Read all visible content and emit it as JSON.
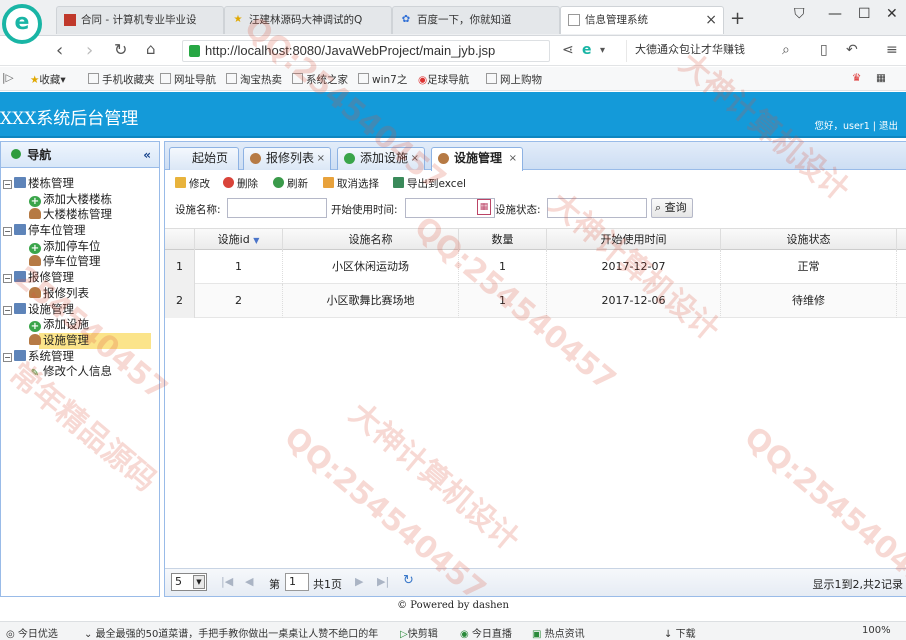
{
  "browser": {
    "tabs": [
      {
        "label": "合同 - 计算机专业毕业设",
        "active": false
      },
      {
        "label": "汪建林源码大神调试的Q",
        "active": false
      },
      {
        "label": "百度一下，你就知道",
        "active": false
      },
      {
        "label": "信息管理系统",
        "active": true
      }
    ],
    "new_tab": "+",
    "url": "http://localhost:8080/JavaWebProject/main_jyb.jsp",
    "search_value": "大德通众包让才华赚钱",
    "bookmarks": [
      "收藏",
      "手机收藏夹",
      "网址导航",
      "淘宝热卖",
      "系统之家",
      "win7之",
      "足球导航",
      "网上购物"
    ]
  },
  "app": {
    "title": "XXX系统后台管理",
    "user_info": "您好，user1 | 退出"
  },
  "sidebar": {
    "title": "导航",
    "collapse": "«",
    "groups": [
      {
        "label": "楼栋管理",
        "items": [
          "添加大楼楼栋",
          "大楼楼栋管理"
        ]
      },
      {
        "label": "停车位管理",
        "items": [
          "添加停车位",
          "停车位管理"
        ]
      },
      {
        "label": "报修管理",
        "items": [
          "报修列表"
        ]
      },
      {
        "label": "设施管理",
        "items": [
          "添加设施",
          "设施管理"
        ]
      },
      {
        "label": "系统管理",
        "items": [
          "修改个人信息"
        ]
      }
    ],
    "selected": "设施管理"
  },
  "page_tabs": [
    {
      "label": "起始页",
      "closable": false
    },
    {
      "label": "报修列表",
      "closable": true
    },
    {
      "label": "添加设施",
      "closable": true
    },
    {
      "label": "设施管理",
      "closable": true,
      "active": true
    }
  ],
  "toolbar": {
    "edit": "修改",
    "delete": "删除",
    "refresh": "刷新",
    "cancel_select": "取消选择",
    "export": "导出到excel"
  },
  "search": {
    "name_label": "设施名称:",
    "date_label": "开始使用时间:",
    "status_label": "设施状态:",
    "query_button": "查询"
  },
  "grid": {
    "columns": [
      "设施id",
      "设施名称",
      "数量",
      "开始使用时间",
      "设施状态"
    ],
    "rows": [
      {
        "num": "1",
        "id": "1",
        "name": "小区休闲运动场",
        "qty": "1",
        "date": "2017-12-07",
        "status": "正常"
      },
      {
        "num": "2",
        "id": "2",
        "name": "小区歌舞比赛场地",
        "qty": "1",
        "date": "2017-12-06",
        "status": "待维修"
      }
    ]
  },
  "pager": {
    "page_size": "5",
    "page_prefix": "第",
    "page_value": "1",
    "page_total": "共1页",
    "summary": "显示1到2,共2记录"
  },
  "footer": "© Powered by dashen",
  "statusbar": {
    "left": "今日优选",
    "news": "最全最强的50道菜谱，手把手教你做出一桌桌让人赞不绝口的年",
    "items": [
      "快剪辑",
      "今日直播",
      "热点资讯"
    ],
    "download": "下载",
    "zoom": "100%"
  },
  "colors": {
    "header": "#149ad9",
    "border": "#99bbe8",
    "selected": "#fbe48a"
  }
}
